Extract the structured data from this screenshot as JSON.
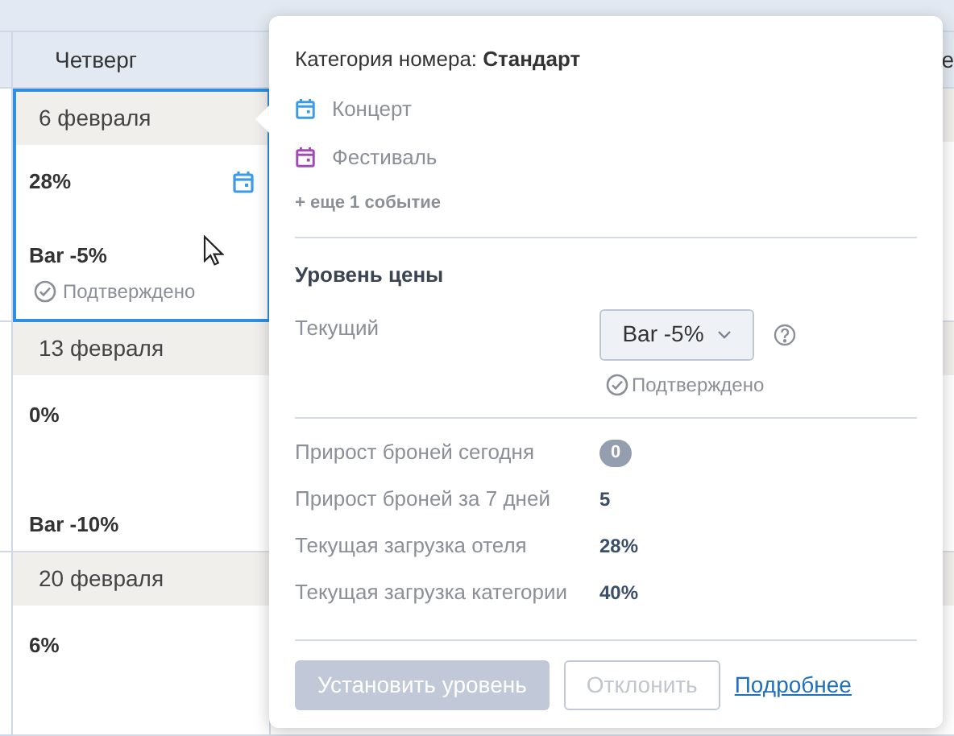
{
  "calendar": {
    "columns": [
      {
        "label": "Четверг"
      },
      {
        "label": "е"
      }
    ],
    "days": [
      {
        "date": "6 февраля",
        "occupancy": "28%",
        "has_events": true,
        "rate": "Bar -5%",
        "status": "Подтверждено",
        "selected": true
      },
      {
        "date": "13 февраля",
        "occupancy": "0%",
        "has_events": false,
        "rate": "Bar -10%",
        "selected": false
      },
      {
        "date": "20 февраля",
        "occupancy": "6%",
        "has_events": false,
        "selected": false
      }
    ]
  },
  "popup": {
    "title": "Категория номера: **Стандарт**",
    "events": [
      {
        "name": "Концерт",
        "color": "#3b9be8"
      },
      {
        "name": "Фестиваль",
        "color": "#a04bb5"
      }
    ],
    "more_events": "+ еще 1 событие",
    "section_title": "Уровень цены",
    "current_label": "Текущий",
    "rate_select": "Bar -5%",
    "status": "Подтверждено",
    "stats": [
      {
        "label": "Прирост броней сегодня",
        "value": "0",
        "kind": "badge"
      },
      {
        "label": "Прирост броней за 7 дней",
        "value": "5",
        "kind": "text"
      },
      {
        "label": "Текущая загрузка отеля",
        "value": "28%",
        "kind": "text"
      },
      {
        "label": "Текущая загрузка категории",
        "value": "40%",
        "kind": "text"
      }
    ],
    "buttons": [
      {
        "label": "Установить уровень",
        "kind": "primary",
        "disabled": true
      },
      {
        "label": "Отклонить",
        "kind": "secondary",
        "disabled": true
      },
      {
        "label": "Подробнее",
        "kind": "link",
        "disabled": false
      }
    ]
  }
}
